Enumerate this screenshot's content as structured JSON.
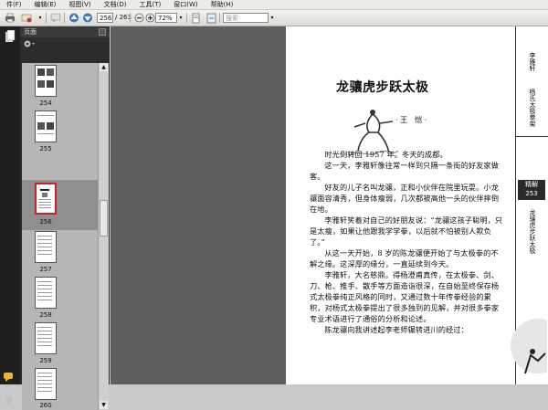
{
  "menu": {
    "items": [
      "件(F)",
      "编辑(E)",
      "视图(V)",
      "文档(D)",
      "工具(T)",
      "窗口(W)",
      "帮助(H)"
    ]
  },
  "toolbar": {
    "page_current": "256",
    "page_total": "/ 263",
    "zoom": "72%",
    "search_placeholder": "搜索"
  },
  "sidebar": {
    "panel_title": "页面",
    "thumbnails": [
      {
        "label": "254",
        "selected": false
      },
      {
        "label": "255",
        "selected": false
      },
      {
        "label": "256",
        "selected": true
      },
      {
        "label": "257",
        "selected": false
      },
      {
        "label": "258",
        "selected": false
      },
      {
        "label": "259",
        "selected": false
      },
      {
        "label": "260",
        "selected": false
      }
    ]
  },
  "document": {
    "title": "龙骧虎步跃太极",
    "author": "· 王　恺 ·",
    "paragraphs": [
      "时光倒转回 1957 年。冬天的成都。",
      "这一天，李雅轩像往常一样到只隔一条街的好友家做客。",
      "好友的儿子名叫龙骧，正和小伙伴在院里玩耍。小龙骧面容清秀，但身体瘦弱，几次都被高他一头的伙伴摔倒在地。",
      "李雅轩笑着对自己的好朋友说：“龙骧这孩子聪明，只是太瘦，如果让他跟我学学拳，以后就不怕被别人欺负了。”",
      "从这一天开始，8 岁的陈龙骧便开始了与太极拳的不解之缘。这深厚的缘分，一直延续到今天。",
      "李雅轩，大名慈鼎。得杨澄甫真传，在太极拳、剑、刀、枪、推手、散手等方面造诣很深，在自始至终保存杨式太极拳纯正风格的同时，又通过数十年传拳经验的累积，对杨式太极拳提出了很多独到的见解，并对很多拳家专业术语进行了通俗的分析和论述。",
      "陈龙骧向我讲述起李老师辗转进川的经过："
    ],
    "strip": {
      "col1": "李雅轩",
      "col2": "杨氏太极拳架",
      "box_top": "精解",
      "box_num": "253",
      "col3": "龙骧虎步跃太极"
    }
  }
}
